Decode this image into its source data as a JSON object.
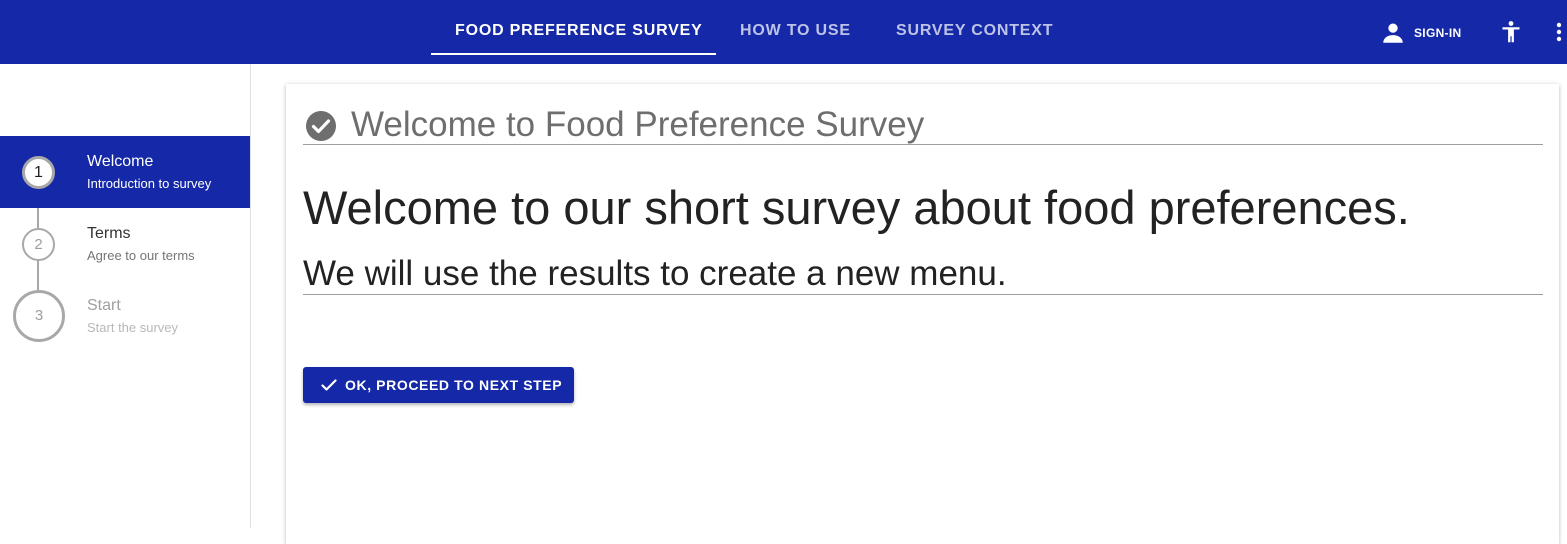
{
  "topbar": {
    "tabs": [
      {
        "label": "FOOD PREFERENCE SURVEY",
        "active": true
      },
      {
        "label": "HOW TO USE",
        "active": false
      },
      {
        "label": "SURVEY CONTEXT",
        "active": false
      }
    ],
    "signin_label": "SIGN-IN",
    "icons": {
      "signin": "person-icon",
      "accessibility": "accessibility-icon",
      "more": "more-vert-icon"
    },
    "colors": {
      "primary": "#1428a8",
      "text_on_primary": "#ffffff"
    }
  },
  "stepper": {
    "steps": [
      {
        "number": "1",
        "title": "Welcome",
        "subtitle": "Introduction to survey",
        "state": "active"
      },
      {
        "number": "2",
        "title": "Terms",
        "subtitle": "Agree to our terms",
        "state": "pending"
      },
      {
        "number": "3",
        "title": "Start",
        "subtitle": "Start the survey",
        "state": "disabled"
      }
    ]
  },
  "main": {
    "card_title": "Welcome to Food Preference Survey",
    "card_title_icon": "check-circle-icon",
    "headline": "Welcome to our short survey about food preferences.",
    "subheadline": "We will use the results to create a new menu.",
    "proceed_button": {
      "label": "OK, PROCEED TO NEXT STEP",
      "icon": "check-icon"
    }
  }
}
